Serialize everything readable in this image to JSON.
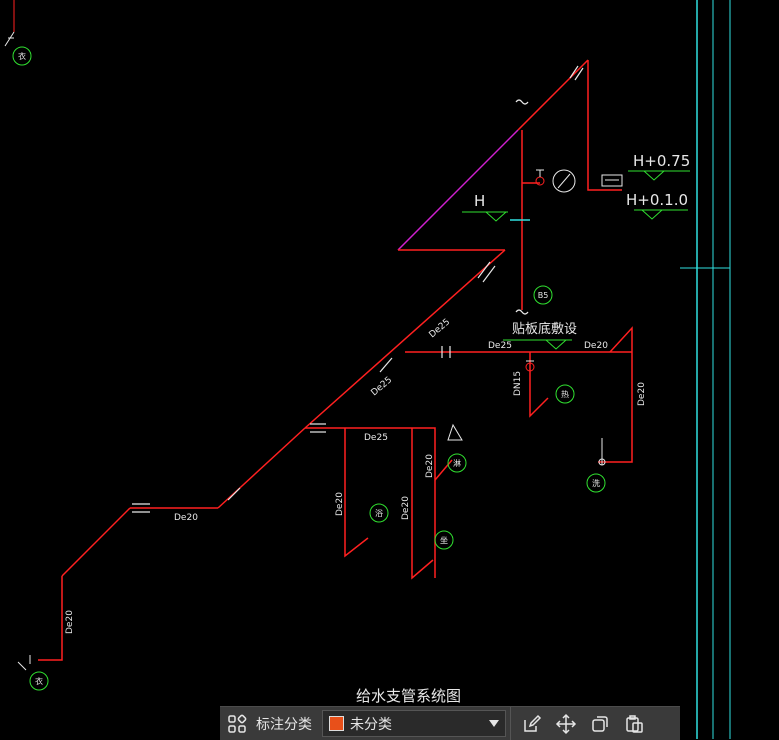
{
  "drawing": {
    "title": "给水支管系统图",
    "colors": {
      "pipe": "#ff2020",
      "pipe_alt": "#d020d0",
      "level": "#30e030",
      "cyan": "#30e0e0",
      "white": "#e8e8e8",
      "tag": "#30e030"
    },
    "elevations": {
      "h_plus_075": "H+0.75",
      "h_plus_010": "H+0.1.0",
      "h": "H"
    },
    "annotations": {
      "floor_slab": "贴板底敷设",
      "de25": "De25",
      "de20": "De20",
      "dn15": "DN15"
    },
    "tags": {
      "t1": "衣",
      "t2": "B5",
      "t3": "热",
      "t4": "洗",
      "t5": "淋",
      "t6": "浴",
      "t7": "坐",
      "t8": "衣"
    }
  },
  "toolbar": {
    "label": "标注分类",
    "selected": "未分类",
    "swatch_color": "#e8501a",
    "icons": [
      "layout-grid-icon",
      "edit-icon",
      "move-icon",
      "copy-icon",
      "paste-icon"
    ]
  }
}
